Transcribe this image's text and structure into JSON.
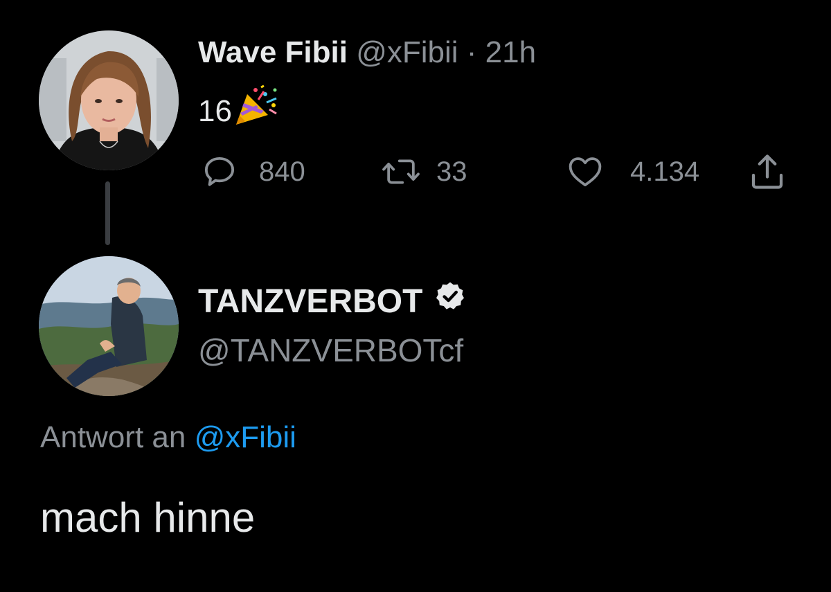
{
  "tweet": {
    "author_name": "Wave Fibii",
    "author_handle": "@xFibii",
    "separator": "·",
    "time": "21h",
    "text": "16",
    "emoji": "party-popper",
    "replies": "840",
    "retweets": "33",
    "likes": "4.134"
  },
  "reply": {
    "author_name": "TANZVERBOT",
    "author_handle": "@TANZVERBOTcf",
    "verified": true,
    "reply_prefix": "Antwort an",
    "reply_mention": "@xFibii",
    "text": "mach hinne"
  },
  "colors": {
    "background": "#000000",
    "text": "#e7e9ea",
    "muted": "#8b9096",
    "link": "#1d9bf0",
    "thread_line": "#3a3d41"
  }
}
